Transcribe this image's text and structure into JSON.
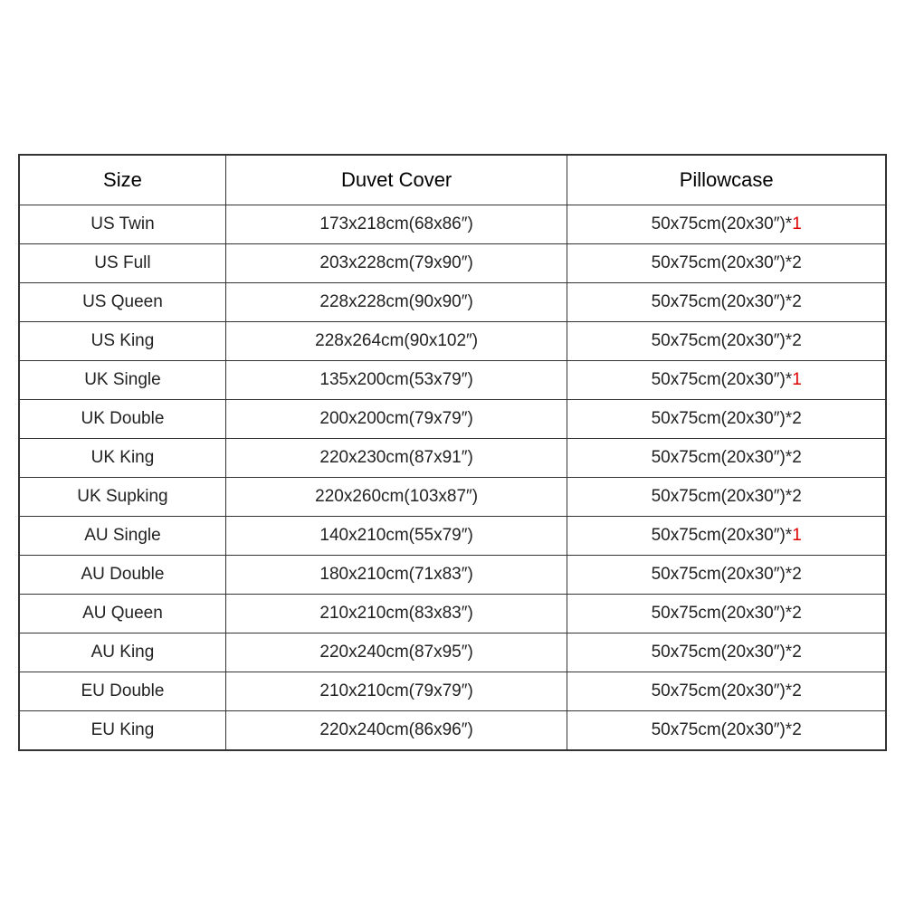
{
  "table": {
    "headers": [
      "Size",
      "Duvet Cover",
      "Pillowcase"
    ],
    "rows": [
      {
        "size": "US Twin",
        "duvet": "173x218cm(68x86″)",
        "pillowcase": "50x75cm(20x30″)*",
        "pillowcase_suffix": "1",
        "red": true
      },
      {
        "size": "US Full",
        "duvet": "203x228cm(79x90″)",
        "pillowcase": "50x75cm(20x30″)*2",
        "pillowcase_suffix": "",
        "red": false
      },
      {
        "size": "US Queen",
        "duvet": "228x228cm(90x90″)",
        "pillowcase": "50x75cm(20x30″)*2",
        "pillowcase_suffix": "",
        "red": false
      },
      {
        "size": "US King",
        "duvet": "228x264cm(90x102″)",
        "pillowcase": "50x75cm(20x30″)*2",
        "pillowcase_suffix": "",
        "red": false
      },
      {
        "size": "UK Single",
        "duvet": "135x200cm(53x79″)",
        "pillowcase": "50x75cm(20x30″)*",
        "pillowcase_suffix": "1",
        "red": true
      },
      {
        "size": "UK Double",
        "duvet": "200x200cm(79x79″)",
        "pillowcase": "50x75cm(20x30″)*2",
        "pillowcase_suffix": "",
        "red": false
      },
      {
        "size": "UK King",
        "duvet": "220x230cm(87x91″)",
        "pillowcase": "50x75cm(20x30″)*2",
        "pillowcase_suffix": "",
        "red": false
      },
      {
        "size": "UK Supking",
        "duvet": "220x260cm(103x87″)",
        "pillowcase": "50x75cm(20x30″)*2",
        "pillowcase_suffix": "",
        "red": false
      },
      {
        "size": "AU Single",
        "duvet": "140x210cm(55x79″)",
        "pillowcase": "50x75cm(20x30″)*",
        "pillowcase_suffix": "1",
        "red": true
      },
      {
        "size": "AU Double",
        "duvet": "180x210cm(71x83″)",
        "pillowcase": "50x75cm(20x30″)*2",
        "pillowcase_suffix": "",
        "red": false
      },
      {
        "size": "AU Queen",
        "duvet": "210x210cm(83x83″)",
        "pillowcase": "50x75cm(20x30″)*2",
        "pillowcase_suffix": "",
        "red": false
      },
      {
        "size": "AU King",
        "duvet": "220x240cm(87x95″)",
        "pillowcase": "50x75cm(20x30″)*2",
        "pillowcase_suffix": "",
        "red": false
      },
      {
        "size": "EU Double",
        "duvet": "210x210cm(79x79″)",
        "pillowcase": "50x75cm(20x30″)*2",
        "pillowcase_suffix": "",
        "red": false
      },
      {
        "size": "EU King",
        "duvet": "220x240cm(86x96″)",
        "pillowcase": "50x75cm(20x30″)*2",
        "pillowcase_suffix": "",
        "red": false
      }
    ]
  }
}
